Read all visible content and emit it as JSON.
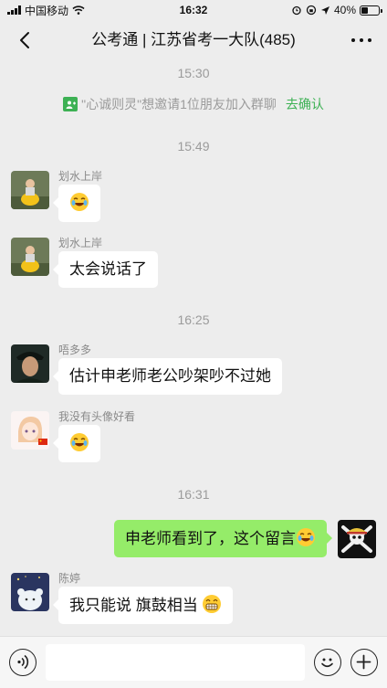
{
  "status_bar": {
    "carrier": "中国移动",
    "time": "16:32",
    "battery_percent": "40%",
    "battery_level": 0.4
  },
  "nav": {
    "title": "公考通 | 江苏省考一大队(485)"
  },
  "chat": {
    "timestamps": [
      "15:30",
      "15:49",
      "16:25",
      "16:31"
    ],
    "system_notice": {
      "text": "\"心诚则灵\"想邀请1位朋友加入群聊",
      "action": "去确认"
    },
    "messages": [
      {
        "sender": "划水上岸",
        "text": "",
        "emoji": "laugh-cry"
      },
      {
        "sender": "划水上岸",
        "text": "太会说话了"
      },
      {
        "sender": "唔多多",
        "text": "估计申老师老公吵架吵不过她"
      },
      {
        "sender": "我没有头像好看",
        "text": "",
        "emoji": "laugh-cry"
      },
      {
        "sender": "",
        "text": "申老师看到了，这个留言",
        "emoji": "laugh-cry",
        "own": true
      },
      {
        "sender": "陈婷",
        "text": "我只能说 旗鼓相当",
        "emoji": "grin"
      }
    ]
  },
  "input": {
    "value": "",
    "placeholder": ""
  },
  "colors": {
    "background": "#ededed",
    "own_bubble": "#95ec69",
    "accent_green": "#3db154"
  }
}
